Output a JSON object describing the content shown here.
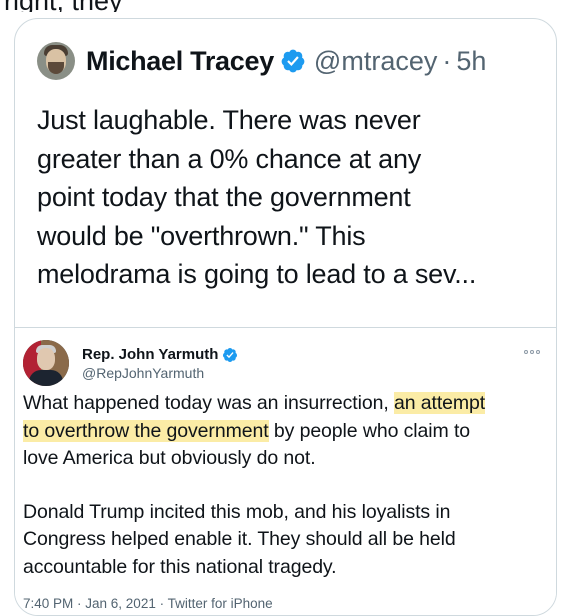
{
  "top_fragment": "right, they",
  "outer_tweet": {
    "author_name": "Michael Tracey",
    "handle": "@mtracey",
    "separator": "·",
    "time": "5h",
    "text_lines": [
      "Just laughable. There was never",
      "greater than a 0% chance at any",
      "point today that the government",
      "would be \"overthrown.\" This",
      "melodrama is going to lead to a sev..."
    ],
    "verified_icon": "verified-badge-icon",
    "accent": "#1d9bf0"
  },
  "quoted_tweet": {
    "author_name": "Rep. John Yarmuth",
    "handle": "@RepJohnYarmuth",
    "more_icon": "more-options-icon",
    "line1_a": "What happened today was an insurrection,",
    "line1_b": "an attempt",
    "line2_a": "to overthrow the government",
    "line2_b": "by people who claim to",
    "line3": "love America but obviously do not.",
    "para2_lines": [
      "Donald Trump incited this mob, and his loyalists in",
      "Congress helped enable it. They should all be held",
      "accountable for this national tragedy."
    ],
    "footer": "7:40 PM · Jan 6, 2021 · Twitter for iPhone",
    "highlight_color": "#fbeca6"
  }
}
